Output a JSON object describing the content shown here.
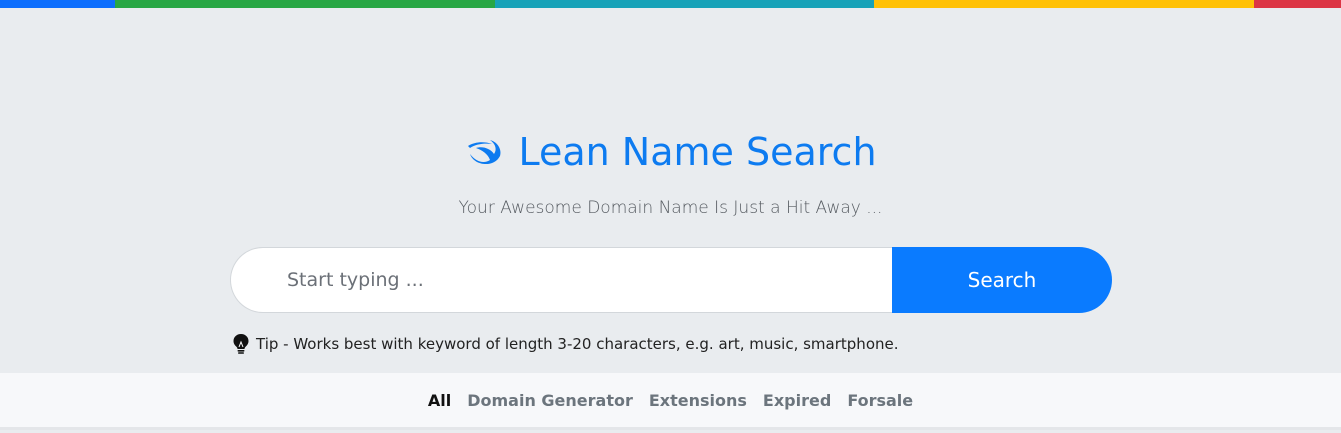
{
  "top_bar_colors": [
    "#0d6efd",
    "#28a745",
    "#17a2b8",
    "#ffc107",
    "#dc3545"
  ],
  "brand": {
    "logo_icon": "swoosh-logo-icon",
    "title": "Lean Name Search",
    "color": "#0d7bf0"
  },
  "tagline": "Your Awesome Domain Name Is Just a Hit Away ...",
  "search": {
    "placeholder": "Start typing ...",
    "value": "",
    "button_label": "Search",
    "button_color": "#0a7bff"
  },
  "tip": {
    "icon": "lightbulb-icon",
    "text": "Tip - Works best with keyword of length 3-20 characters, e.g. art, music, smartphone."
  },
  "nav": {
    "items": [
      {
        "label": "All",
        "active": true
      },
      {
        "label": "Domain Generator",
        "active": false
      },
      {
        "label": "Extensions",
        "active": false
      },
      {
        "label": "Expired",
        "active": false
      },
      {
        "label": "Forsale",
        "active": false
      }
    ]
  }
}
